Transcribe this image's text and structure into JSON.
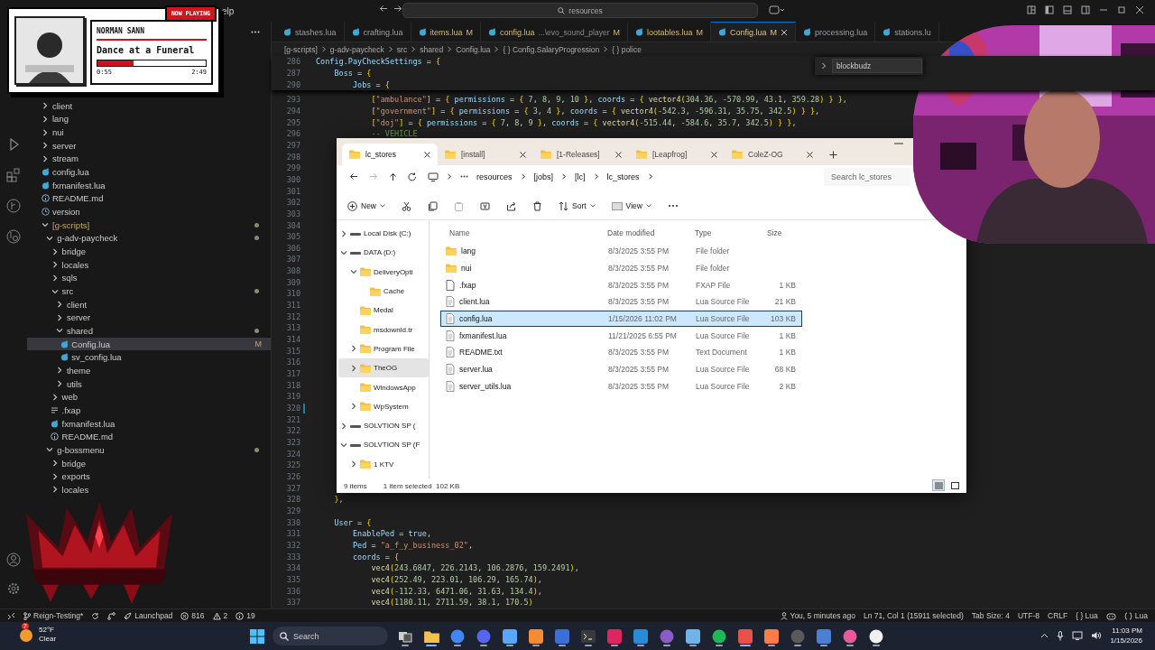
{
  "title_bar": {
    "menu": [
      "elp"
    ],
    "search": {
      "value": "resources"
    }
  },
  "now_playing": {
    "badge": "NOW PLAYING",
    "artist": "NORMAN SANN",
    "track": "Dance at a Funeral",
    "level": 0.33,
    "elapsed": "0:55",
    "duration": "2:49"
  },
  "tabs": [
    {
      "label": "stashes.lua",
      "modified": false,
      "selected": false
    },
    {
      "label": "crafting.lua",
      "modified": false,
      "selected": false
    },
    {
      "label": "items.lua",
      "badge": "M",
      "modified": true,
      "selected": false
    },
    {
      "label": "config.lua",
      "description": "...\\evo_sound_player",
      "badge": "M",
      "modified": true,
      "selected": false
    },
    {
      "label": "lootables.lua",
      "badge": "M",
      "modified": true,
      "selected": false
    },
    {
      "label": "Config.lua",
      "badge": "M",
      "modified": true,
      "selected": true
    },
    {
      "label": "processing.lua",
      "modified": false,
      "selected": false
    },
    {
      "label": "stations.lu",
      "modified": false,
      "selected": false
    }
  ],
  "breadcrumb": [
    "[g-scripts]",
    "g-adv-paycheck",
    "src",
    "shared",
    "Config.lua",
    "{ } Config.SalaryProgression",
    "{ } police"
  ],
  "find_widget": {
    "value": "blockbudz"
  },
  "sidebar": {
    "tree": [
      {
        "label": "client",
        "kind": "folder",
        "expanded": false
      },
      {
        "label": "lang",
        "kind": "folder",
        "expanded": false
      },
      {
        "label": "nui",
        "kind": "folder",
        "expanded": false
      },
      {
        "label": "server",
        "kind": "folder",
        "expanded": false
      },
      {
        "label": "stream",
        "kind": "folder",
        "expanded": false
      },
      {
        "label": "config.lua",
        "kind": "lua"
      },
      {
        "label": "fxmanifest.lua",
        "kind": "lua"
      },
      {
        "label": "README.md",
        "kind": "info"
      },
      {
        "label": "version",
        "kind": "clock"
      },
      {
        "label": "[g-scripts]",
        "kind": "folder",
        "expanded": true,
        "dot": true,
        "children": [
          {
            "label": "g-adv-paycheck",
            "kind": "folder",
            "expanded": true,
            "dot": true,
            "children": [
              {
                "label": "bridge",
                "kind": "folder",
                "expanded": false
              },
              {
                "label": "locales",
                "kind": "folder",
                "expanded": false
              },
              {
                "label": "sqls",
                "kind": "folder",
                "expanded": false
              },
              {
                "label": "src",
                "kind": "folder",
                "expanded": true,
                "dot": true,
                "children": [
                  {
                    "label": "client",
                    "kind": "folder",
                    "expanded": false
                  },
                  {
                    "label": "server",
                    "kind": "folder",
                    "expanded": false
                  },
                  {
                    "label": "shared",
                    "kind": "folder",
                    "expanded": true,
                    "dot": true,
                    "children": [
                      {
                        "label": "Config.lua",
                        "kind": "lua",
                        "badge": "M",
                        "selected": true
                      },
                      {
                        "label": "sv_config.lua",
                        "kind": "lua",
                        "selected": false
                      }
                    ]
                  },
                  {
                    "label": "theme",
                    "kind": "folder",
                    "expanded": false
                  },
                  {
                    "label": "utils",
                    "kind": "folder",
                    "expanded": false
                  }
                ]
              },
              {
                "label": "web",
                "kind": "folder",
                "expanded": false
              },
              {
                "label": ".fxap",
                "kind": "lines"
              },
              {
                "label": "fxmanifest.lua",
                "kind": "lua"
              },
              {
                "label": "README.md",
                "kind": "info"
              }
            ]
          },
          {
            "label": "g-bossmenu",
            "kind": "folder",
            "expanded": true,
            "dot": true,
            "children": [
              {
                "label": "bridge",
                "kind": "folder",
                "expanded": false
              },
              {
                "label": "exports",
                "kind": "folder",
                "expanded": false
              },
              {
                "label": "locales",
                "kind": "folder",
                "expanded": false
              }
            ]
          }
        ]
      }
    ]
  },
  "editor": {
    "sticky": [
      {
        "number": "286",
        "code": "Config.PayCheckSettings = {"
      },
      {
        "number": "287",
        "code": "    Boss = {"
      },
      {
        "number": "290",
        "code": "        Jobs = {"
      }
    ],
    "lines": [
      {
        "number": "293",
        "code": "            [\"ambulance\"] = { permissions = { 7, 8, 9, 10 }, coords = { vector4(304.36, -570.99, 43.1, 359.28) } },"
      },
      {
        "number": "294",
        "code": "            [\"government\"] = { permissions = { 3, 4 }, coords = { vector4(-542.3, -596.31, 35.75, 342.5) } },"
      },
      {
        "number": "295",
        "code": "            [\"doj\"] = { permissions = { 7, 8, 9 }, coords = { vector4(-515.44, -584.6, 35.7, 342.5) } },"
      },
      {
        "number": "296",
        "code": "            -- VEHICLE"
      },
      {
        "number": "297"
      },
      {
        "number": "298"
      },
      {
        "number": "299"
      },
      {
        "number": "300"
      },
      {
        "number": "301"
      },
      {
        "number": "302"
      },
      {
        "number": "303"
      },
      {
        "number": "304"
      },
      {
        "number": "305"
      },
      {
        "number": "306"
      },
      {
        "number": "307"
      },
      {
        "number": "308"
      },
      {
        "number": "309"
      },
      {
        "number": "310"
      },
      {
        "number": "311"
      },
      {
        "number": "312"
      },
      {
        "number": "313"
      },
      {
        "number": "314"
      },
      {
        "number": "315"
      },
      {
        "number": "316"
      },
      {
        "number": "317"
      },
      {
        "number": "318"
      },
      {
        "number": "319"
      },
      {
        "number": "320",
        "changed": true
      },
      {
        "number": "321"
      },
      {
        "number": "322"
      },
      {
        "number": "323"
      },
      {
        "number": "324"
      },
      {
        "number": "325"
      },
      {
        "number": "326"
      },
      {
        "number": "327"
      },
      {
        "number": "328",
        "code": "    },"
      },
      {
        "number": "329"
      },
      {
        "number": "330",
        "code": "    User = {"
      },
      {
        "number": "331",
        "code": "        EnablePed = true,"
      },
      {
        "number": "332",
        "code": "        Ped = \"a_f_y_business_02\","
      },
      {
        "number": "333",
        "code": "        coords = {"
      },
      {
        "number": "334",
        "code": "            vec4(243.6847, 226.2143, 106.2876, 159.2491),"
      },
      {
        "number": "335",
        "code": "            vec4(252.49, 223.01, 106.29, 165.74),"
      },
      {
        "number": "336",
        "code": "            vec4(-112.33, 6471.06, 31.63, 134.4),"
      },
      {
        "number": "337",
        "code": "            vec4(1180.11, 2711.59, 38.1, 170.5)"
      }
    ]
  },
  "file_explorer": {
    "tabs": [
      {
        "label": "lc_stores",
        "selected": true
      },
      {
        "label": "[install]",
        "selected": false
      },
      {
        "label": "[1-Releases]",
        "selected": false
      },
      {
        "label": "[Leapfrog]",
        "selected": false
      },
      {
        "label": "ColeZ-OG",
        "selected": false
      }
    ],
    "path": [
      "resources",
      "[jobs]",
      "[lc]",
      "lc_stores"
    ],
    "search": {
      "placeholder": "Search lc_stores"
    },
    "toolbar": [
      {
        "kind": "new",
        "label": "New",
        "disabled": false
      },
      {
        "kind": "cut",
        "disabled": false
      },
      {
        "kind": "copy",
        "disabled": false
      },
      {
        "kind": "paste",
        "disabled": true
      },
      {
        "kind": "rename",
        "disabled": false
      },
      {
        "kind": "share",
        "disabled": false
      },
      {
        "kind": "delete",
        "disabled": false
      },
      {
        "kind": "sort",
        "label": "Sort",
        "disabled": false
      },
      {
        "kind": "view",
        "label": "View",
        "disabled": false
      },
      {
        "kind": "more",
        "disabled": false
      }
    ],
    "nav": [
      {
        "label": "Local Disk (C:)",
        "kind": "drive",
        "expanded": false,
        "selected": false
      },
      {
        "label": "DATA (D:)",
        "kind": "drive",
        "expanded": true,
        "selected": false,
        "children": [
          {
            "label": "DeliveryOpti",
            "kind": "folder",
            "expanded": true,
            "selected": false,
            "children": [
              {
                "label": "Cache",
                "kind": "folder",
                "selected": false
              }
            ]
          },
          {
            "label": "Medal",
            "kind": "folder",
            "selected": false
          },
          {
            "label": "msdownld.tr",
            "kind": "folder",
            "selected": false
          },
          {
            "label": "Program File",
            "kind": "folder",
            "expanded": false,
            "selected": false
          },
          {
            "label": "TheOG",
            "kind": "folder",
            "expanded": false,
            "selected": true
          },
          {
            "label": "WindowsApp",
            "kind": "folder",
            "selected": false
          },
          {
            "label": "WpSystem",
            "kind": "folder",
            "expanded": false,
            "selected": false
          }
        ]
      },
      {
        "label": "SOLVTION SP (",
        "kind": "drive",
        "expanded": false,
        "selected": false
      },
      {
        "label": "SOLVTION SP (F",
        "kind": "drive",
        "expanded": true,
        "selected": false,
        "children": [
          {
            "label": "1 KTV",
            "kind": "folder",
            "expanded": false,
            "selected": false
          }
        ]
      }
    ],
    "columns": [
      "Name",
      "Date modified",
      "Type",
      "Size"
    ],
    "files": [
      {
        "name": "lang",
        "date": "8/3/2025 3:55 PM",
        "type": "File folder",
        "kind": "folder",
        "selected": false
      },
      {
        "name": "nui",
        "date": "8/3/2025 3:55 PM",
        "type": "File folder",
        "kind": "folder",
        "selected": false
      },
      {
        "name": ".fxap",
        "date": "8/3/2025 3:55 PM",
        "type": "FXAP File",
        "size": "1 KB",
        "kind": "file",
        "selected": false
      },
      {
        "name": "client.lua",
        "date": "8/3/2025 3:55 PM",
        "type": "Lua Source File",
        "size": "21 KB",
        "kind": "doc",
        "selected": false
      },
      {
        "name": "config.lua",
        "date": "1/15/2026 11:02 PM",
        "type": "Lua Source File",
        "size": "103 KB",
        "kind": "doc",
        "selected": true
      },
      {
        "name": "fxmanifest.lua",
        "date": "11/21/2025 6:55 PM",
        "type": "Lua Source File",
        "size": "1 KB",
        "kind": "doc",
        "selected": false
      },
      {
        "name": "README.txt",
        "date": "8/3/2025 3:55 PM",
        "type": "Text Document",
        "size": "1 KB",
        "kind": "doc",
        "selected": false
      },
      {
        "name": "server.lua",
        "date": "8/3/2025 3:55 PM",
        "type": "Lua Source File",
        "size": "68 KB",
        "kind": "doc",
        "selected": false
      },
      {
        "name": "server_utils.lua",
        "date": "8/3/2025 3:55 PM",
        "type": "Lua Source File",
        "size": "2 KB",
        "kind": "doc",
        "selected": false
      }
    ],
    "status": {
      "count": "9 items",
      "selection": "1 item selected  102 KB"
    },
    "views": [
      {
        "kind": "details",
        "selected": true
      },
      {
        "kind": "tiles",
        "selected": false
      }
    ]
  },
  "status_bar": {
    "left": [
      {
        "kind": "remote"
      },
      {
        "kind": "branch",
        "text": "Reign-Testing*"
      },
      {
        "kind": "sync"
      },
      {
        "kind": "graph"
      },
      {
        "kind": "launchpad",
        "text": "Launchpad"
      },
      {
        "kind": "errors",
        "text": "816"
      },
      {
        "kind": "warnings",
        "text": "2"
      },
      {
        "kind": "info",
        "text": "19"
      }
    ],
    "right": [
      {
        "kind": "blame",
        "text": "You, 5 minutes ago"
      },
      {
        "kind": "plain",
        "text": "Ln 71, Col 1 (15911 selected)"
      },
      {
        "kind": "plain",
        "text": "Tab Size: 4"
      },
      {
        "kind": "plain",
        "text": "UTF-8"
      },
      {
        "kind": "plain",
        "text": "CRLF"
      },
      {
        "kind": "plain",
        "text": "{ } Lua"
      },
      {
        "kind": "copilot"
      },
      {
        "kind": "lang",
        "text": "Lua"
      }
    ]
  },
  "taskbar": {
    "weather": {
      "badge": "7",
      "temperature": "52°F",
      "condition": "Clear"
    },
    "search": {
      "placeholder": "Search"
    },
    "apps": [
      {
        "kind": "taskview",
        "color": "#d0d0d0",
        "active": false
      },
      {
        "kind": "folder",
        "color": "#f2c14e",
        "active": true
      },
      {
        "kind": "circle",
        "color": "#4285f4",
        "active": false
      },
      {
        "kind": "circle",
        "color": "#5865f2",
        "active": false
      },
      {
        "kind": "square",
        "color": "#58a6ff",
        "active": false
      },
      {
        "kind": "square",
        "color": "#f58b32",
        "active": false
      },
      {
        "kind": "square",
        "color": "#3b6fd8",
        "active": false
      },
      {
        "kind": "terminal",
        "color": "#3a3a3a",
        "active": false
      },
      {
        "kind": "square",
        "color": "#e0245e",
        "active": false
      },
      {
        "kind": "square",
        "color": "#2b8ad6",
        "active": false
      },
      {
        "kind": "circle",
        "color": "#8b5cc7",
        "active": false
      },
      {
        "kind": "square",
        "color": "#6fb3e8",
        "active": false
      },
      {
        "kind": "circle",
        "color": "#1db954",
        "active": false
      },
      {
        "kind": "square",
        "color": "#e8504a",
        "active": true
      },
      {
        "kind": "square",
        "color": "#ff7a45",
        "active": false
      },
      {
        "kind": "circle",
        "color": "#5a5a5a",
        "active": false
      },
      {
        "kind": "square",
        "color": "#4a7fd1",
        "active": false
      },
      {
        "kind": "circle",
        "color": "#e85a9a",
        "active": false
      },
      {
        "kind": "circle",
        "color": "#f0f0f0",
        "active": false
      }
    ],
    "time": "11:03 PM",
    "date": "1/15/2026"
  }
}
